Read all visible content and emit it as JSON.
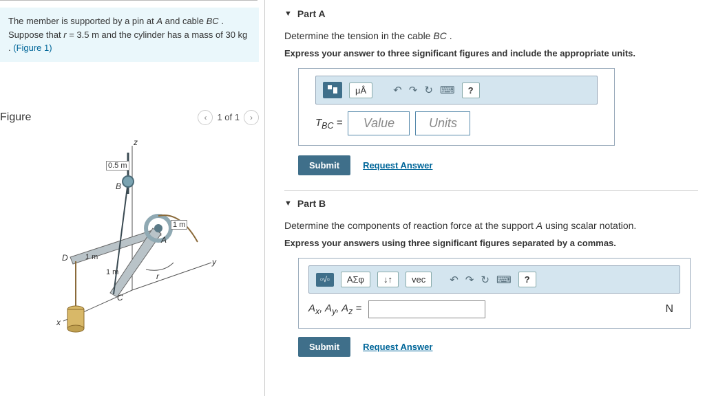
{
  "problem": {
    "line1_pre": "The member is supported by a pin at ",
    "varA": "A",
    "line1_mid": " and cable ",
    "varBC": "BC",
    "line1_post": ". Suppose that ",
    "varR": "r",
    "eq": " = 3.5  m",
    "line2": " and the cylinder has a mass of 30  kg . ",
    "fig_link": "(Figure 1)"
  },
  "figure": {
    "title": "Figure",
    "pager": "1 of 1",
    "labels": {
      "z": "z",
      "y": "y",
      "x": "x",
      "r": "r",
      "half": "0.5 m",
      "one": "1 m",
      "onem2": "1 m",
      "onem3": "1 m",
      "A": "A",
      "B": "B",
      "C": "C",
      "D": "D"
    }
  },
  "partA": {
    "title": "Part A",
    "prompt_pre": "Determine the tension in the cable ",
    "prompt_var": "BC",
    "prompt_post": ".",
    "instruct": "Express your answer to three significant figures and include the appropriate units.",
    "toolbar": {
      "units": "μÅ",
      "help": "?"
    },
    "var_label": "T",
    "var_sub": "BC",
    "eq": " = ",
    "value_ph": "Value",
    "units_ph": "Units",
    "submit": "Submit",
    "request": "Request Answer"
  },
  "partB": {
    "title": "Part B",
    "prompt_pre": "Determine the components of reaction force at the support ",
    "prompt_var": "A",
    "prompt_post": " using scalar notation.",
    "instruct": "Express your answers using three significant figures separated by a commas.",
    "toolbar": {
      "sym": "ΑΣφ",
      "vec": "vec",
      "help": "?"
    },
    "var_label": "Aₓ, A_y, A_z = ",
    "unit": "N",
    "submit": "Submit",
    "request": "Request Answer"
  }
}
